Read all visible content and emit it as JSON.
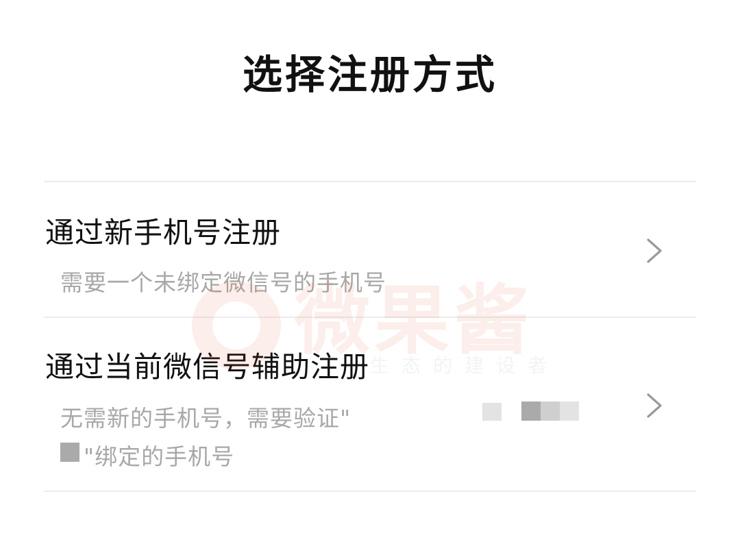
{
  "page": {
    "title": "选择注册方式"
  },
  "options": [
    {
      "title": "通过新手机号注册",
      "description": "需要一个未绑定微信号的手机号"
    },
    {
      "title": "通过当前微信号辅助注册",
      "description_line1": "无需新的手机号，需要验证\"",
      "description_line2": "\"绑定的手机号"
    }
  ],
  "watermark": {
    "brand": "微果酱",
    "tagline": "生态的建设者"
  },
  "colors": {
    "title": "#111111",
    "description": "#a8a8a8",
    "divider": "#ececec",
    "chevron": "#9a9a9a",
    "watermark": "#e8501f"
  },
  "icons": {
    "row_arrow": "chevron-right-icon",
    "watermark_logo": "weiguojiang-logo"
  }
}
